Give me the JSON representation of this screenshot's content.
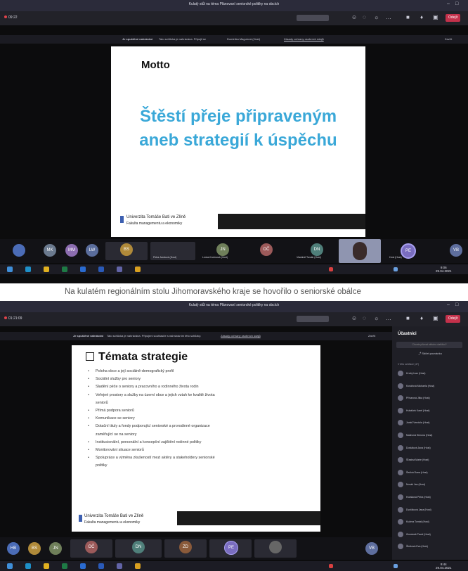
{
  "caption": "Na kulatém regionálním stolu Jihomoravského kraje se hovořilo o seniorské obálce",
  "shot1": {
    "window_title": "Kulatý stůl na téma Plánovaní seniorské politiky na obcích",
    "timer": "09:22",
    "leave_label": "Odejít",
    "banner_warning": "Je spuštěné nahrávání",
    "banner_text": "Tato schůzka je nahrávána. Připojil se",
    "banner_name": "Dominika Magulová (Host)",
    "banner_link": "Zásady ochrany osobních údajů",
    "dismiss": "Zavřít",
    "slide": {
      "motto": "Motto",
      "line1": "Štěstí přeje připraveným",
      "line2": "aneb strategií k úspěchu",
      "univ": "Univerzita Tomáše Bati ve Zlíně",
      "faculty": "Fakulta managementu a ekonomiky"
    },
    "avatars": [
      "MK",
      "MM",
      "LW",
      "BS",
      "JN",
      "OČ",
      "DN",
      "PE",
      "VB"
    ],
    "tiles": [
      "Petra Jandová (Host)",
      "Lenka Kudrnová (Host)",
      "Vlastimil Tomák (Host)",
      "Host (Host)"
    ],
    "clock_time": "9:06",
    "clock_date": "29.04.2021"
  },
  "shot2": {
    "window_title": "Kulatý stůl na téma Plánovaní seniorské politiky na obcích",
    "timer": "01:21:09",
    "leave_label": "Odejít",
    "banner_warning": "Je spuštěné nahrávání",
    "banner_text": "Tato schůzka je nahrávána. Připojeni souhlasíte s nahráváním této schůzky.",
    "banner_link": "Zásady ochrany osobních údajů",
    "dismiss": "Zavřít",
    "slide": {
      "title": "Témata strategie",
      "bullets": [
        "Poloha obce a její sociálně-demografický profil",
        "Sociální služby pro seniory",
        "Sladění péče o seniory a pracovního a rodinného života rodin",
        "Veřejné prostory a služby na území obce a jejich vztah ke kvalitě života",
        "seniorů",
        "Přímá podpora seniorů",
        "Komunikace se seniory",
        "Dotační tituly a fondy podporující seniorské a prorodinné organizace",
        "zaměřující se na seniory",
        "Institucionální, personální a koncepční zajištění rodinné politiky",
        "Monitorování situace seniorů",
        "Spolupráce a výměna zkušeností mezi aktéry a stakeholdery seniorské",
        "politiky"
      ],
      "univ": "Univerzita Tomáše Bati ve Zlíně",
      "faculty": "Fakulta managementu a ekonomiky"
    },
    "panel": {
      "header": "Účastníci",
      "search": "Chcete přizvat někoho dalšího?",
      "share": "Sdílet pozvánku",
      "section": "V této schůzce (47)",
      "participants": [
        "Hrubý Ivan (Host)",
        "Kovářová Michaela (Host)",
        "Přívarová Jitka (Host)",
        "Hubáček Karel (Host)",
        "Janků Vendula (Host)",
        "Malinová Simona (Host)",
        "Dostálová Jana (Host)",
        "Šťastná Marie (Host)",
        "Šedivá Dana (Host)",
        "Novák Jan (Host)",
        "Horáková Petra (Host)",
        "Dvořáková Jana (Host)",
        "Kučera Tomáš (Host)",
        "Zemánek Pavel (Host)",
        "Šimková Eva (Host)"
      ]
    },
    "avatars": [
      "HB",
      "BS",
      "JN",
      "OČ",
      "DN",
      "ZD",
      "PE",
      "VB"
    ],
    "clock_time": "9:44",
    "clock_date": "29.04.2021"
  }
}
